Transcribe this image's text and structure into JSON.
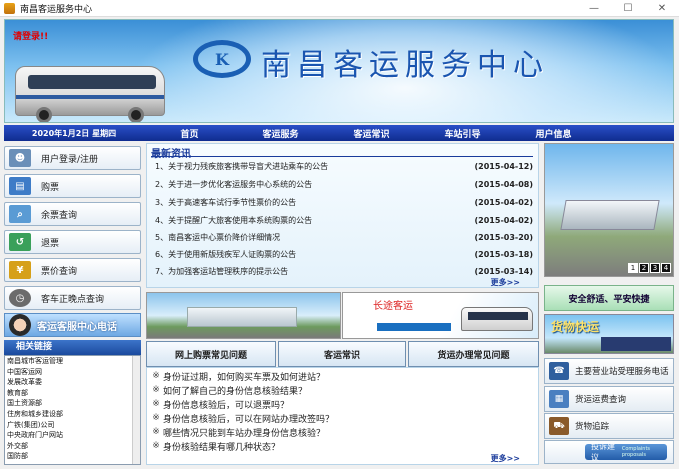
{
  "window": {
    "title": "南昌客运服务中心",
    "controls": [
      "minimize-icon",
      "maximize-icon",
      "close-icon"
    ]
  },
  "banner": {
    "login_hint": "请登录!!",
    "brand": "南昌客运服务中心",
    "logo_letter": "K"
  },
  "nav": {
    "date": "2020年1月2日 星期四",
    "items": [
      "首页",
      "客运服务",
      "客运常识",
      "车站引导",
      "用户信息"
    ]
  },
  "sidebar": {
    "buttons": [
      {
        "label": "用户登录/注册",
        "icon": "user-icon"
      },
      {
        "label": "购票",
        "icon": "ticket-icon"
      },
      {
        "label": "余票查询",
        "icon": "search-icon"
      },
      {
        "label": "退票",
        "icon": "refund-icon"
      },
      {
        "label": "票价查询",
        "icon": "price-icon"
      },
      {
        "label": "客车正晚点查询",
        "icon": "clock-icon"
      }
    ],
    "service_phone": "客运客服中心电话",
    "links_title": "相关链接",
    "links": [
      "南昌城市客运管理",
      "中国客运网",
      "发展改革委",
      "教育部",
      "国土资源部",
      "住房和城乡建设部",
      "广铁(集团)公司",
      "中央政府门户网站",
      "外交部",
      "国防部"
    ]
  },
  "news": {
    "title": "最新资讯",
    "items": [
      {
        "text": "1、关于视力残疾旅客携带导盲犬进站乘车的公告",
        "date": "(2015-04-12)"
      },
      {
        "text": "2、关于进一步优化客运服务中心系统的公告",
        "date": "(2015-04-08)"
      },
      {
        "text": "3、关于高速客车试行季节性票价的公告",
        "date": "(2015-04-02)"
      },
      {
        "text": "4、关于提醒广大旅客使用本系统购票的公告",
        "date": "(2015-04-02)"
      },
      {
        "text": "5、南昌客运中心票价降价详细情况",
        "date": "(2015-03-20)"
      },
      {
        "text": "6、关于使用新版残疾军人证购票的公告",
        "date": "(2015-03-18)"
      },
      {
        "text": "7、为加强客运站管理秩序的提示公告",
        "date": "(2015-03-14)"
      }
    ],
    "more": "更多>>"
  },
  "promo": {
    "slogan": "长途客运"
  },
  "faq": {
    "tabs": [
      "网上购票常见问题",
      "客运常识",
      "货运办理常见问题"
    ],
    "items": [
      "身份证过期，如何购买车票及如何进站？",
      "如何了解自己的身份信息核验结果？",
      "身份信息核验后，可以退票吗？",
      "身份信息核验后，可以在网站办理改签吗？",
      "哪些情况只能到车站办理身份信息核验？",
      "身份核验结果有哪几种状态？"
    ],
    "more": "更多>>"
  },
  "right": {
    "pager": [
      "1",
      "2",
      "3",
      "4"
    ],
    "safe_slogan": "安全舒适、平安快捷",
    "cargo_title": "货物快运",
    "buttons": [
      {
        "label": "主要营业站受理服务电话",
        "icon": "phone-icon"
      },
      {
        "label": "货运运费查询",
        "icon": "freight-icon"
      },
      {
        "label": "货物追踪",
        "icon": "track-icon"
      }
    ],
    "feedback": "投诉建议",
    "feedback_sub": "Complaints proposals"
  }
}
